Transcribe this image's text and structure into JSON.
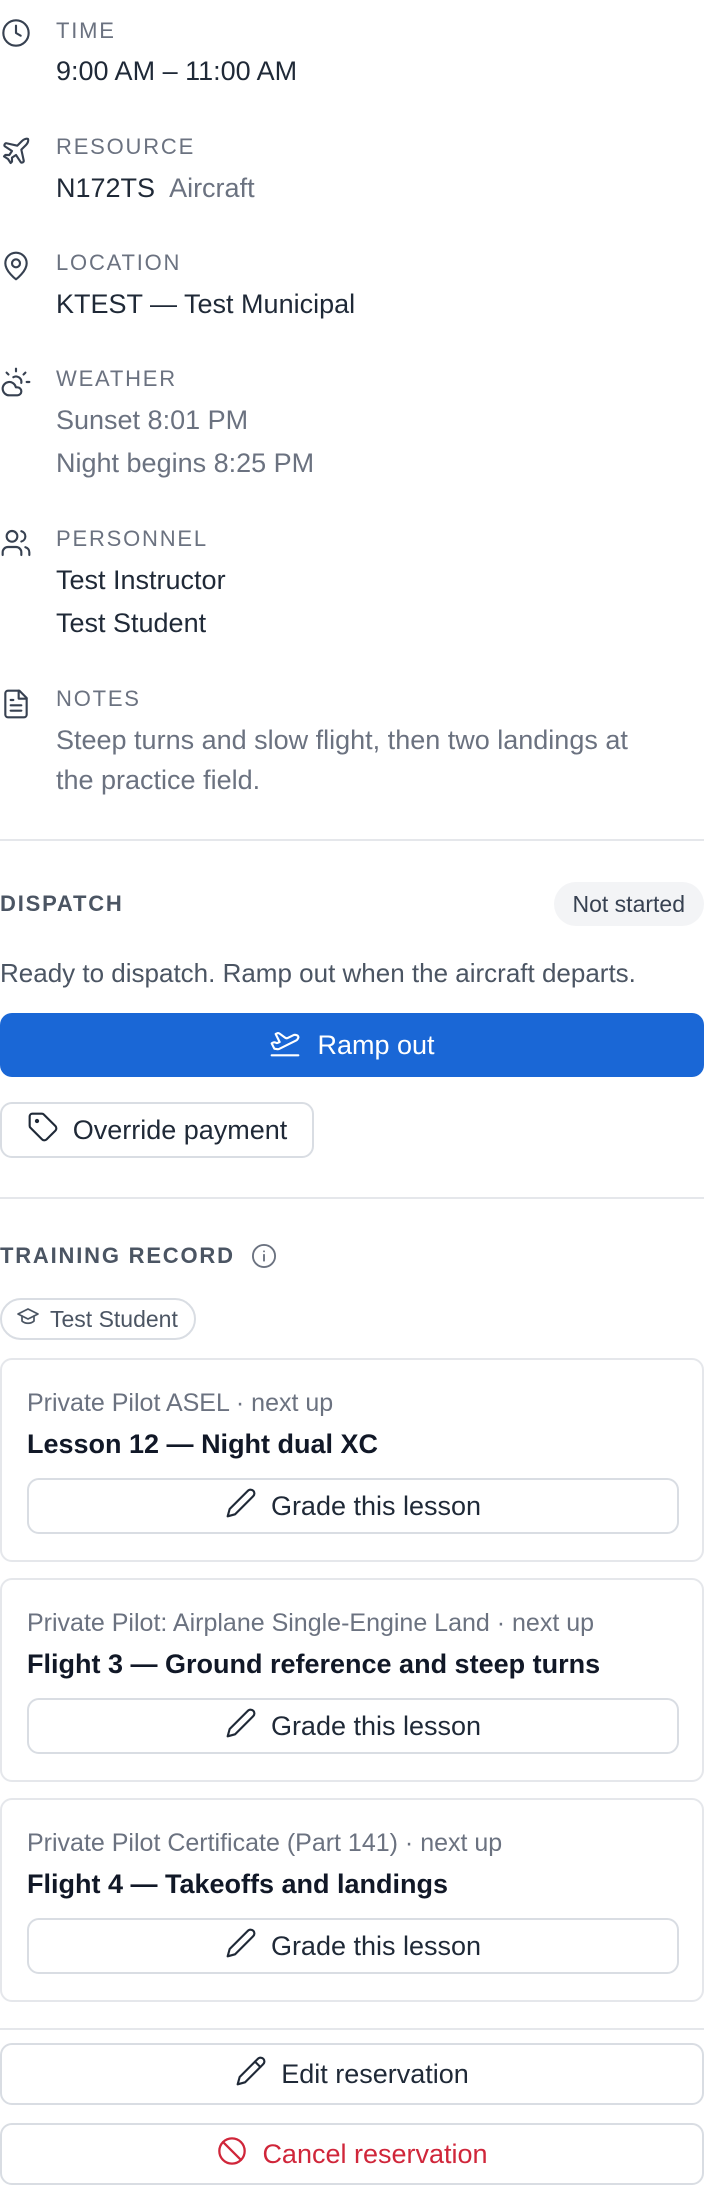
{
  "details": {
    "time": {
      "label": "TIME",
      "value": "9:00 AM – 11:00 AM",
      "icon": "clock-icon"
    },
    "resource": {
      "label": "RESOURCE",
      "value": "N172TS",
      "sub": "Aircraft",
      "icon": "plane-icon"
    },
    "location": {
      "label": "LOCATION",
      "value": "KTEST — Test Municipal",
      "icon": "map-pin-icon"
    },
    "weather": {
      "label": "WEATHER",
      "line1": "Sunset 8:01 PM",
      "line2": "Night begins 8:25 PM",
      "icon": "cloud-sun-icon"
    },
    "personnel": {
      "label": "PERSONNEL",
      "line1": "Test Instructor",
      "line2": "Test Student",
      "icon": "users-icon"
    },
    "notes": {
      "label": "NOTES",
      "line1": "Steep turns and slow flight, then two landings at",
      "line2": "the practice field.",
      "icon": "file-text-icon"
    }
  },
  "dispatch": {
    "label": "DISPATCH",
    "status": "Not started",
    "text": "Ready to dispatch. Ramp out when the aircraft departs.",
    "ramp_out": "Ramp out",
    "override_payment": "Override payment"
  },
  "training": {
    "label": "TRAINING RECORD",
    "student": "Test Student",
    "cards": [
      {
        "program": "Private Pilot ASEL · next up",
        "lesson": "Lesson 12 — Night dual XC",
        "grade": "Grade this lesson"
      },
      {
        "program": "Private Pilot: Airplane Single-Engine Land · next up",
        "lesson": "Flight 3 — Ground reference and steep turns",
        "grade": "Grade this lesson"
      },
      {
        "program": "Private Pilot Certificate (Part 141) · next up",
        "lesson": "Flight 4 — Takeoffs and landings",
        "grade": "Grade this lesson"
      }
    ]
  },
  "actions": {
    "edit": "Edit reservation",
    "cancel": "Cancel reservation"
  },
  "colors": {
    "primary": "#1a67d6",
    "danger": "#d0263a",
    "muted": "#6b7280",
    "border": "#d9dde3"
  }
}
